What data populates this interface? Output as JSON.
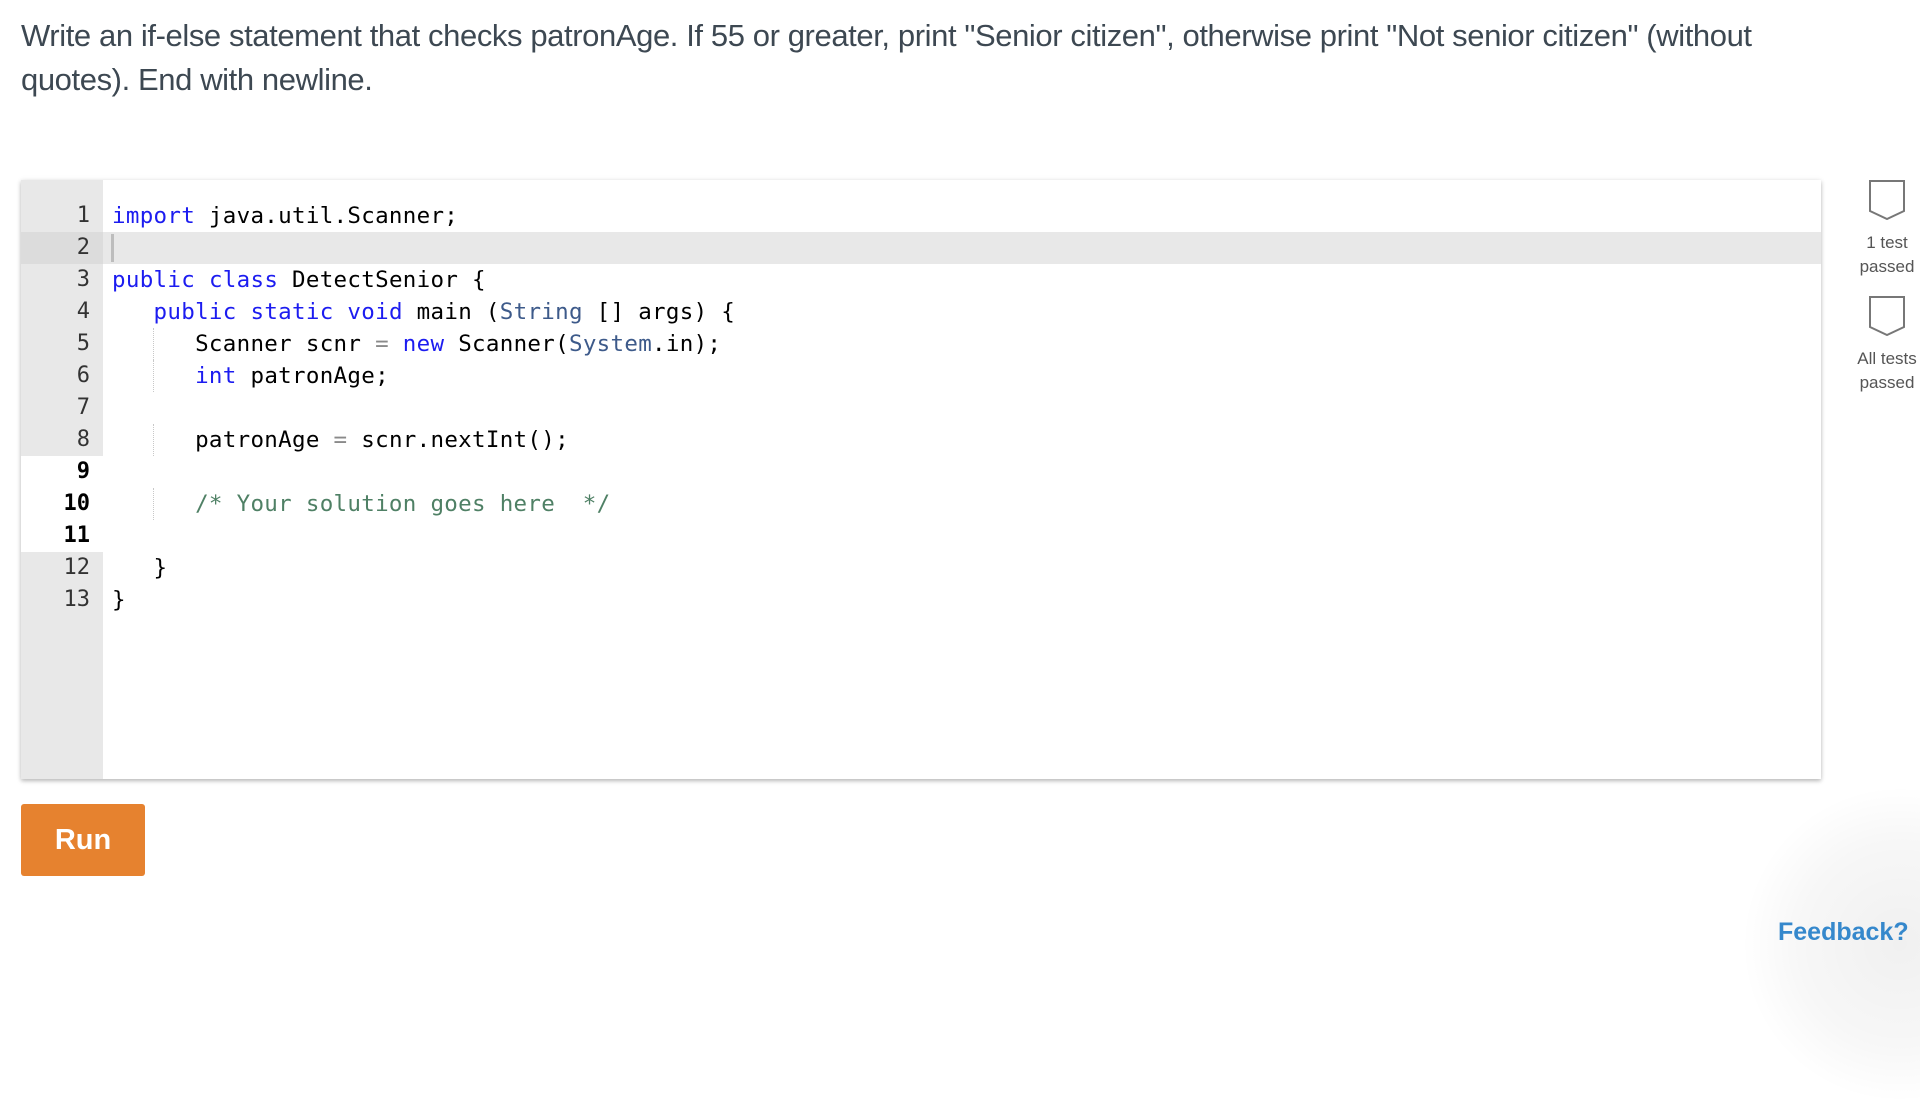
{
  "prompt": {
    "text": "Write an if-else statement that checks patronAge. If 55 or greater, print \"Senior citizen\", otherwise print \"Not senior citizen\" (without quotes). End with newline."
  },
  "editor": {
    "language": "java",
    "active_line": 2,
    "editable_lines": [
      9,
      10,
      11
    ],
    "lines": [
      {
        "n": "1",
        "tokens": [
          {
            "t": "import",
            "c": "kw"
          },
          {
            "t": " java.util.Scanner;",
            "c": ""
          }
        ]
      },
      {
        "n": "2",
        "tokens": []
      },
      {
        "n": "3",
        "tokens": [
          {
            "t": "public",
            "c": "kw"
          },
          {
            "t": " ",
            "c": ""
          },
          {
            "t": "class",
            "c": "kw"
          },
          {
            "t": " DetectSenior {",
            "c": ""
          }
        ]
      },
      {
        "n": "4",
        "tokens": [
          {
            "t": "   ",
            "c": ""
          },
          {
            "t": "public",
            "c": "kw"
          },
          {
            "t": " ",
            "c": ""
          },
          {
            "t": "static",
            "c": "kw"
          },
          {
            "t": " ",
            "c": ""
          },
          {
            "t": "void",
            "c": "kw"
          },
          {
            "t": " main (",
            "c": ""
          },
          {
            "t": "String",
            "c": "ty"
          },
          {
            "t": " [] args) {",
            "c": ""
          }
        ]
      },
      {
        "n": "5",
        "tokens": [
          {
            "t": "      Scanner scnr ",
            "c": ""
          },
          {
            "t": "=",
            "c": "op"
          },
          {
            "t": " ",
            "c": ""
          },
          {
            "t": "new",
            "c": "kw"
          },
          {
            "t": " Scanner(",
            "c": ""
          },
          {
            "t": "System",
            "c": "ty"
          },
          {
            "t": ".in);",
            "c": ""
          }
        ]
      },
      {
        "n": "6",
        "tokens": [
          {
            "t": "      ",
            "c": ""
          },
          {
            "t": "int",
            "c": "kw"
          },
          {
            "t": " patronAge;",
            "c": ""
          }
        ]
      },
      {
        "n": "7",
        "tokens": []
      },
      {
        "n": "8",
        "tokens": [
          {
            "t": "      patronAge ",
            "c": ""
          },
          {
            "t": "=",
            "c": "op"
          },
          {
            "t": " scnr.nextInt();",
            "c": ""
          }
        ]
      },
      {
        "n": "9",
        "tokens": []
      },
      {
        "n": "10",
        "tokens": [
          {
            "t": "      ",
            "c": ""
          },
          {
            "t": "/* Your solution goes here  */",
            "c": "cm"
          }
        ]
      },
      {
        "n": "11",
        "tokens": []
      },
      {
        "n": "12",
        "tokens": [
          {
            "t": "   }",
            "c": ""
          }
        ]
      },
      {
        "n": "13",
        "tokens": [
          {
            "t": "}",
            "c": ""
          }
        ]
      }
    ]
  },
  "status": [
    {
      "icon": "test-badge-icon",
      "label_line1": "1 test",
      "label_line2": "passed",
      "passed": false
    },
    {
      "icon": "test-badge-icon",
      "label_line1": "All tests",
      "label_line2": "passed",
      "passed": false
    }
  ],
  "run_button": {
    "label": "Run",
    "color": "#e6822f"
  },
  "feedback": {
    "label": "Feedback?",
    "color": "#3588cc"
  }
}
